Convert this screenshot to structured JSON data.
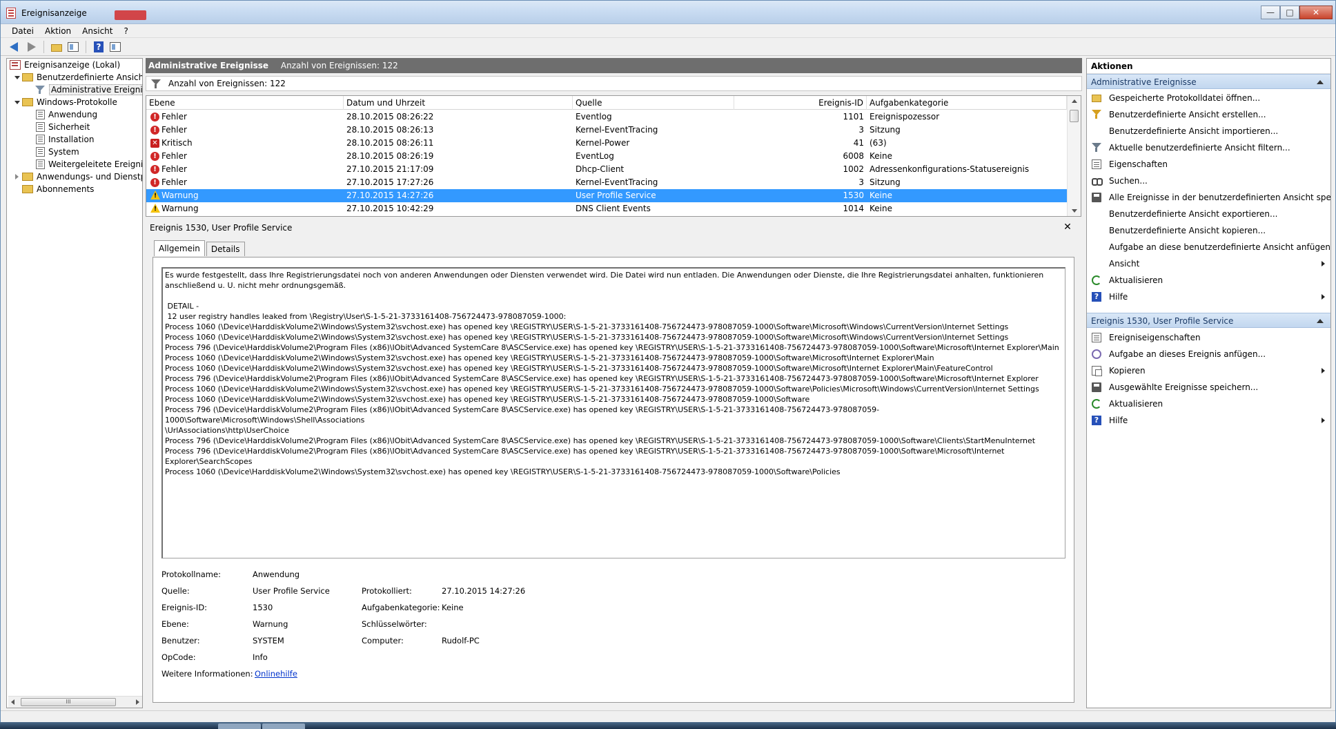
{
  "window": {
    "title": "Ereignisanzeige",
    "controls": {
      "minimize": "—",
      "maximize": "□",
      "close": "✕"
    }
  },
  "menu": [
    "Datei",
    "Aktion",
    "Ansicht",
    "?"
  ],
  "toolbar": {
    "icons": [
      "back-arrow-icon",
      "forward-arrow-icon",
      "folder-up-icon",
      "show-hide-tree-icon",
      "help-icon",
      "show-hide-action-pane-icon"
    ],
    "help_glyph": "?"
  },
  "tree": {
    "root": "Ereignisanzeige (Lokal)",
    "custom_views": "Benutzerdefinierte Ansichten",
    "admin_events": "Administrative Ereignisse",
    "windows_logs": "Windows-Protokolle",
    "logs": [
      "Anwendung",
      "Sicherheit",
      "Installation",
      "System",
      "Weitergeleitete Ereignisse"
    ],
    "app_services": "Anwendungs- und Dienstprotokolle",
    "subscriptions": "Abonnements",
    "scroll_thumb": "III"
  },
  "center": {
    "header_title": "Administrative Ereignisse",
    "header_count": "Anzahl von Ereignissen: 122",
    "filter_text": "Anzahl von Ereignissen: 122",
    "columns": [
      "Ebene",
      "Datum und Uhrzeit",
      "Quelle",
      "Ereignis-ID",
      "Aufgabenkategorie"
    ],
    "rows": [
      {
        "level": "Fehler",
        "icon": "error",
        "date": "28.10.2015 08:26:22",
        "source": "Eventlog",
        "id": "1101",
        "category": "Ereignispozessor"
      },
      {
        "level": "Fehler",
        "icon": "error",
        "date": "28.10.2015 08:26:13",
        "source": "Kernel-EventTracing",
        "id": "3",
        "category": "Sitzung"
      },
      {
        "level": "Kritisch",
        "icon": "critical",
        "date": "28.10.2015 08:26:11",
        "source": "Kernel-Power",
        "id": "41",
        "category": "(63)"
      },
      {
        "level": "Fehler",
        "icon": "error",
        "date": "28.10.2015 08:26:19",
        "source": "EventLog",
        "id": "6008",
        "category": "Keine"
      },
      {
        "level": "Fehler",
        "icon": "error",
        "date": "27.10.2015 21:17:09",
        "source": "Dhcp-Client",
        "id": "1002",
        "category": "Adressenkonfigurations-Statusereignis"
      },
      {
        "level": "Fehler",
        "icon": "error",
        "date": "27.10.2015 17:27:26",
        "source": "Kernel-EventTracing",
        "id": "3",
        "category": "Sitzung"
      },
      {
        "level": "Warnung",
        "icon": "warning",
        "date": "27.10.2015 14:27:26",
        "source": "User Profile Service",
        "id": "1530",
        "category": "Keine",
        "selected": true
      },
      {
        "level": "Warnung",
        "icon": "warning",
        "date": "27.10.2015 10:42:29",
        "source": "DNS Client Events",
        "id": "1014",
        "category": "Keine"
      }
    ],
    "icon_glyphs": {
      "error": "!",
      "critical": "✕",
      "warning": "!"
    }
  },
  "detail": {
    "title": "Ereignis 1530, User Profile Service",
    "close_glyph": "✕",
    "tabs": [
      "Allgemein",
      "Details"
    ],
    "message": "Es wurde festgestellt, dass Ihre Registrierungsdatei noch von anderen Anwendungen oder Diensten verwendet wird. Die Datei wird nun entladen. Die Anwendungen oder Dienste, die Ihre Registrierungsdatei anhalten, funktionieren anschließend u. U. nicht mehr ordnungsgemäß.\n\n DETAIL - \n 12 user registry handles leaked from \\Registry\\User\\S-1-5-21-3733161408-756724473-978087059-1000:\nProcess 1060 (\\Device\\HarddiskVolume2\\Windows\\System32\\svchost.exe) has opened key \\REGISTRY\\USER\\S-1-5-21-3733161408-756724473-978087059-1000\\Software\\Microsoft\\Windows\\CurrentVersion\\Internet Settings\nProcess 1060 (\\Device\\HarddiskVolume2\\Windows\\System32\\svchost.exe) has opened key \\REGISTRY\\USER\\S-1-5-21-3733161408-756724473-978087059-1000\\Software\\Microsoft\\Windows\\CurrentVersion\\Internet Settings\nProcess 796 (\\Device\\HarddiskVolume2\\Program Files (x86)\\IObit\\Advanced SystemCare 8\\ASCService.exe) has opened key \\REGISTRY\\USER\\S-1-5-21-3733161408-756724473-978087059-1000\\Software\\Microsoft\\Internet Explorer\\Main\nProcess 1060 (\\Device\\HarddiskVolume2\\Windows\\System32\\svchost.exe) has opened key \\REGISTRY\\USER\\S-1-5-21-3733161408-756724473-978087059-1000\\Software\\Microsoft\\Internet Explorer\\Main\nProcess 1060 (\\Device\\HarddiskVolume2\\Windows\\System32\\svchost.exe) has opened key \\REGISTRY\\USER\\S-1-5-21-3733161408-756724473-978087059-1000\\Software\\Microsoft\\Internet Explorer\\Main\\FeatureControl\nProcess 796 (\\Device\\HarddiskVolume2\\Program Files (x86)\\IObit\\Advanced SystemCare 8\\ASCService.exe) has opened key \\REGISTRY\\USER\\S-1-5-21-3733161408-756724473-978087059-1000\\Software\\Microsoft\\Internet Explorer\nProcess 1060 (\\Device\\HarddiskVolume2\\Windows\\System32\\svchost.exe) has opened key \\REGISTRY\\USER\\S-1-5-21-3733161408-756724473-978087059-1000\\Software\\Policies\\Microsoft\\Windows\\CurrentVersion\\Internet Settings\nProcess 1060 (\\Device\\HarddiskVolume2\\Windows\\System32\\svchost.exe) has opened key \\REGISTRY\\USER\\S-1-5-21-3733161408-756724473-978087059-1000\\Software\nProcess 796 (\\Device\\HarddiskVolume2\\Program Files (x86)\\IObit\\Advanced SystemCare 8\\ASCService.exe) has opened key \\REGISTRY\\USER\\S-1-5-21-3733161408-756724473-978087059-1000\\Software\\Microsoft\\Windows\\Shell\\Associations\n\\UrlAssociations\\http\\UserChoice\nProcess 796 (\\Device\\HarddiskVolume2\\Program Files (x86)\\IObit\\Advanced SystemCare 8\\ASCService.exe) has opened key \\REGISTRY\\USER\\S-1-5-21-3733161408-756724473-978087059-1000\\Software\\Clients\\StartMenuInternet\nProcess 796 (\\Device\\HarddiskVolume2\\Program Files (x86)\\IObit\\Advanced SystemCare 8\\ASCService.exe) has opened key \\REGISTRY\\USER\\S-1-5-21-3733161408-756724473-978087059-1000\\Software\\Microsoft\\Internet Explorer\\SearchScopes\nProcess 1060 (\\Device\\HarddiskVolume2\\Windows\\System32\\svchost.exe) has opened key \\REGISTRY\\USER\\S-1-5-21-3733161408-756724473-978087059-1000\\Software\\Policies",
    "props": {
      "log_name_label": "Protokollname:",
      "log_name": "Anwendung",
      "source_label": "Quelle:",
      "source": "User Profile Service",
      "logged_label": "Protokolliert:",
      "logged": "27.10.2015 14:27:26",
      "event_id_label": "Ereignis-ID:",
      "event_id": "1530",
      "task_cat_label": "Aufgabenkategorie:",
      "task_cat": "Keine",
      "level_label": "Ebene:",
      "level": "Warnung",
      "keywords_label": "Schlüsselwörter:",
      "keywords": "",
      "user_label": "Benutzer:",
      "user": "SYSTEM",
      "computer_label": "Computer:",
      "computer": "Rudolf-PC",
      "opcode_label": "OpCode:",
      "opcode": "Info",
      "more_info_label": "Weitere Informationen:",
      "more_info_link": "Onlinehilfe"
    }
  },
  "actions": {
    "title": "Aktionen",
    "section1": "Administrative Ereignisse",
    "section1_items": [
      {
        "label": "Gespeicherte Protokolldatei öffnen...",
        "icon": "folder",
        "name": "open-saved-log"
      },
      {
        "label": "Benutzerdefinierte Ansicht erstellen...",
        "icon": "funnel",
        "name": "create-custom-view"
      },
      {
        "label": "Benutzerdefinierte Ansicht importieren...",
        "icon": "",
        "name": "import-custom-view"
      },
      {
        "label": "Aktuelle benutzerdefinierte Ansicht filtern...",
        "icon": "funnelg",
        "name": "filter-current-view"
      },
      {
        "label": "Eigenschaften",
        "icon": "props",
        "name": "properties"
      },
      {
        "label": "Suchen...",
        "icon": "find",
        "name": "find"
      },
      {
        "label": "Alle Ereignisse in der benutzerdefinierten Ansicht speic...",
        "icon": "save",
        "name": "save-all-events"
      },
      {
        "label": "Benutzerdefinierte Ansicht exportieren...",
        "icon": "",
        "name": "export-custom-view"
      },
      {
        "label": "Benutzerdefinierte Ansicht kopieren...",
        "icon": "",
        "name": "copy-custom-view"
      },
      {
        "label": "Aufgabe an diese benutzerdefinierte Ansicht anfügen...",
        "icon": "",
        "name": "attach-task-view"
      },
      {
        "label": "Ansicht",
        "icon": "",
        "name": "view-submenu",
        "submenu": true
      },
      {
        "label": "Aktualisieren",
        "icon": "refresh",
        "name": "refresh"
      },
      {
        "label": "Hilfe",
        "icon": "help",
        "name": "help-submenu",
        "submenu": true
      }
    ],
    "section2": "Ereignis 1530, User Profile Service",
    "section2_items": [
      {
        "label": "Ereigniseigenschaften",
        "icon": "props",
        "name": "event-properties"
      },
      {
        "label": "Aufgabe an dieses Ereignis anfügen...",
        "icon": "task",
        "name": "attach-task-event"
      },
      {
        "label": "Kopieren",
        "icon": "copy",
        "name": "copy-submenu",
        "submenu": true
      },
      {
        "label": "Ausgewählte Ereignisse speichern...",
        "icon": "save",
        "name": "save-selected-events"
      },
      {
        "label": "Aktualisieren",
        "icon": "refresh",
        "name": "refresh-event"
      },
      {
        "label": "Hilfe",
        "icon": "help",
        "name": "help-event-submenu",
        "submenu": true
      }
    ],
    "help_glyph": "?"
  }
}
